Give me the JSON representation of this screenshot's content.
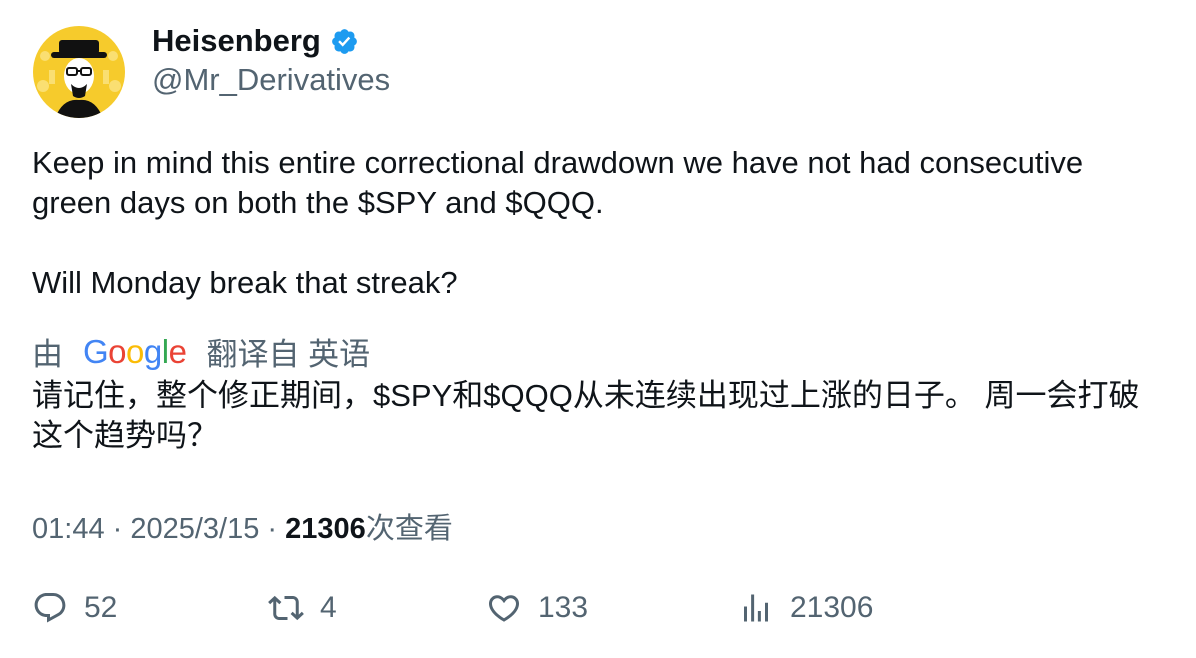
{
  "author": {
    "display_name": "Heisenberg",
    "handle": "@Mr_Derivatives",
    "verified_icon": "verified-badge-icon",
    "avatar_icon": "heisenberg-avatar"
  },
  "tweet": {
    "text_line1": "Keep in mind this entire correctional drawdown we have not had consecutive green days on both the $SPY and $QQQ.",
    "text_line2": "Will Monday break that streak?"
  },
  "translation": {
    "prefix": "由",
    "provider_letters": [
      "G",
      "o",
      "o",
      "g",
      "l",
      "e"
    ],
    "suffix": "翻译自 英语",
    "text": "请记住，整个修正期间，$SPY和$QQQ从未连续出现过上涨的日子。 周一会打破这个趋势吗？"
  },
  "meta": {
    "time": "01:44",
    "separator1": " · ",
    "date": "2025/3/15",
    "separator2": " · ",
    "views_count": "21306",
    "views_label": "次查看"
  },
  "actions": {
    "reply_count": "52",
    "retweet_count": "4",
    "like_count": "133",
    "views_count": "21306"
  },
  "colors": {
    "text_primary": "#0f1419",
    "text_secondary": "#536471",
    "verified_blue": "#1d9bf0",
    "avatar_yellow": "#f6cb2c"
  }
}
